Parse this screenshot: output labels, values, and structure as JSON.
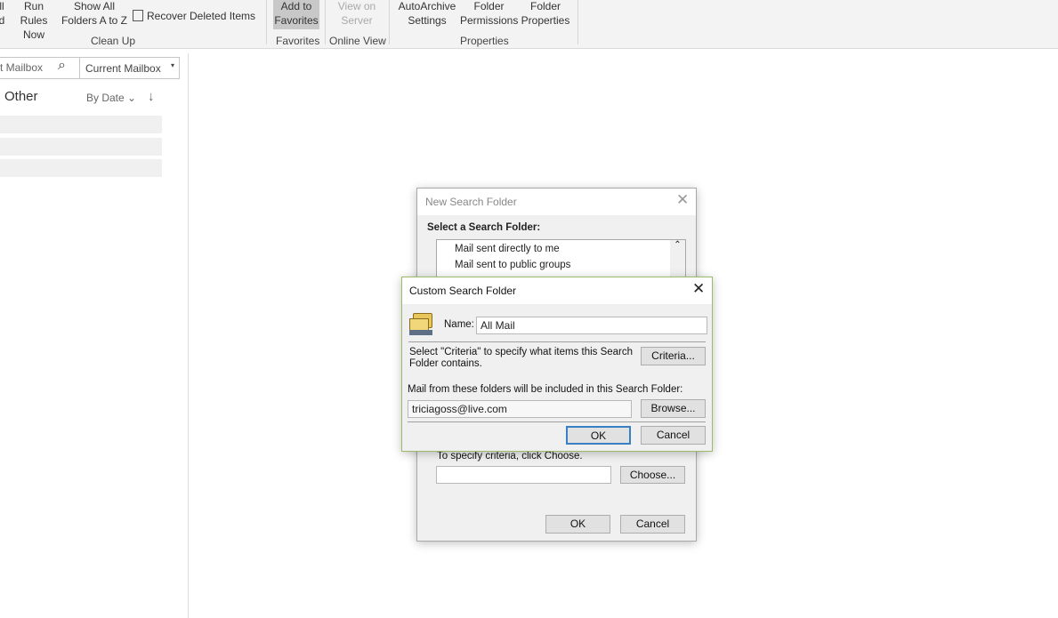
{
  "ribbon": {
    "partial_a": [
      "ll",
      "d"
    ],
    "run_rules": [
      "Run Rules",
      "Now"
    ],
    "show_all": [
      "Show All",
      "Folders A to Z"
    ],
    "recover": "Recover Deleted Items",
    "clean_up": "Clean Up",
    "add_fav": [
      "Add to",
      "Favorites"
    ],
    "favorites": "Favorites",
    "view_server": [
      "View on",
      "Server"
    ],
    "online_view": "Online View",
    "autoarchive": [
      "AutoArchive",
      "Settings"
    ],
    "folder_perm": [
      "Folder",
      "Permissions"
    ],
    "folder_prop": [
      "Folder",
      "Properties"
    ],
    "properties": "Properties"
  },
  "search": {
    "placeholder": "t Mailbox",
    "scope": "Current Mailbox"
  },
  "list": {
    "tab": "Other",
    "sort": "By Date"
  },
  "new_search_folder": {
    "title": "New Search Folder",
    "select_label": "Select a Search Folder:",
    "items": [
      "Mail sent directly to me",
      "Mail sent to public groups"
    ],
    "criteria_text": "To specify criteria, click Choose.",
    "choose": "Choose...",
    "ok": "OK",
    "cancel": "Cancel"
  },
  "custom_search_folder": {
    "title": "Custom Search Folder",
    "name_label": "Name:",
    "name_value": "All Mail",
    "criteria_text": "Select \"Criteria\" to specify what items this Search Folder contains.",
    "criteria_btn": "Criteria...",
    "folders_label": "Mail from these folders will be included in this Search Folder:",
    "folders_value": "triciagoss@live.com",
    "browse": "Browse...",
    "ok": "OK",
    "cancel": "Cancel"
  }
}
